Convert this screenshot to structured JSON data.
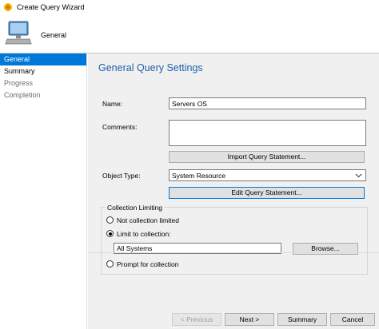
{
  "window": {
    "title": "Create Query Wizard"
  },
  "header": {
    "title": "General"
  },
  "nav": {
    "items": [
      {
        "label": "General"
      },
      {
        "label": "Summary"
      },
      {
        "label": "Progress"
      },
      {
        "label": "Completion"
      }
    ]
  },
  "main": {
    "section_title": "General Query Settings",
    "name_label": "Name:",
    "name_value": "Servers OS",
    "comments_label": "Comments:",
    "comments_value": "",
    "import_button": "Import Query Statement...",
    "object_type_label": "Object Type:",
    "object_type_value": "System Resource",
    "edit_button": "Edit Query Statement...",
    "collection": {
      "title": "Collection Limiting",
      "opt_not_limited": "Not collection limited",
      "opt_limit_to": "Limit to collection:",
      "collection_value": "All Systems",
      "browse_button": "Browse...",
      "opt_prompt": "Prompt for collection"
    }
  },
  "footer": {
    "previous": "< Previous",
    "next": "Next >",
    "summary": "Summary",
    "cancel": "Cancel"
  },
  "colors": {
    "accent": "#0078d7",
    "section_title": "#1f5fa8"
  }
}
